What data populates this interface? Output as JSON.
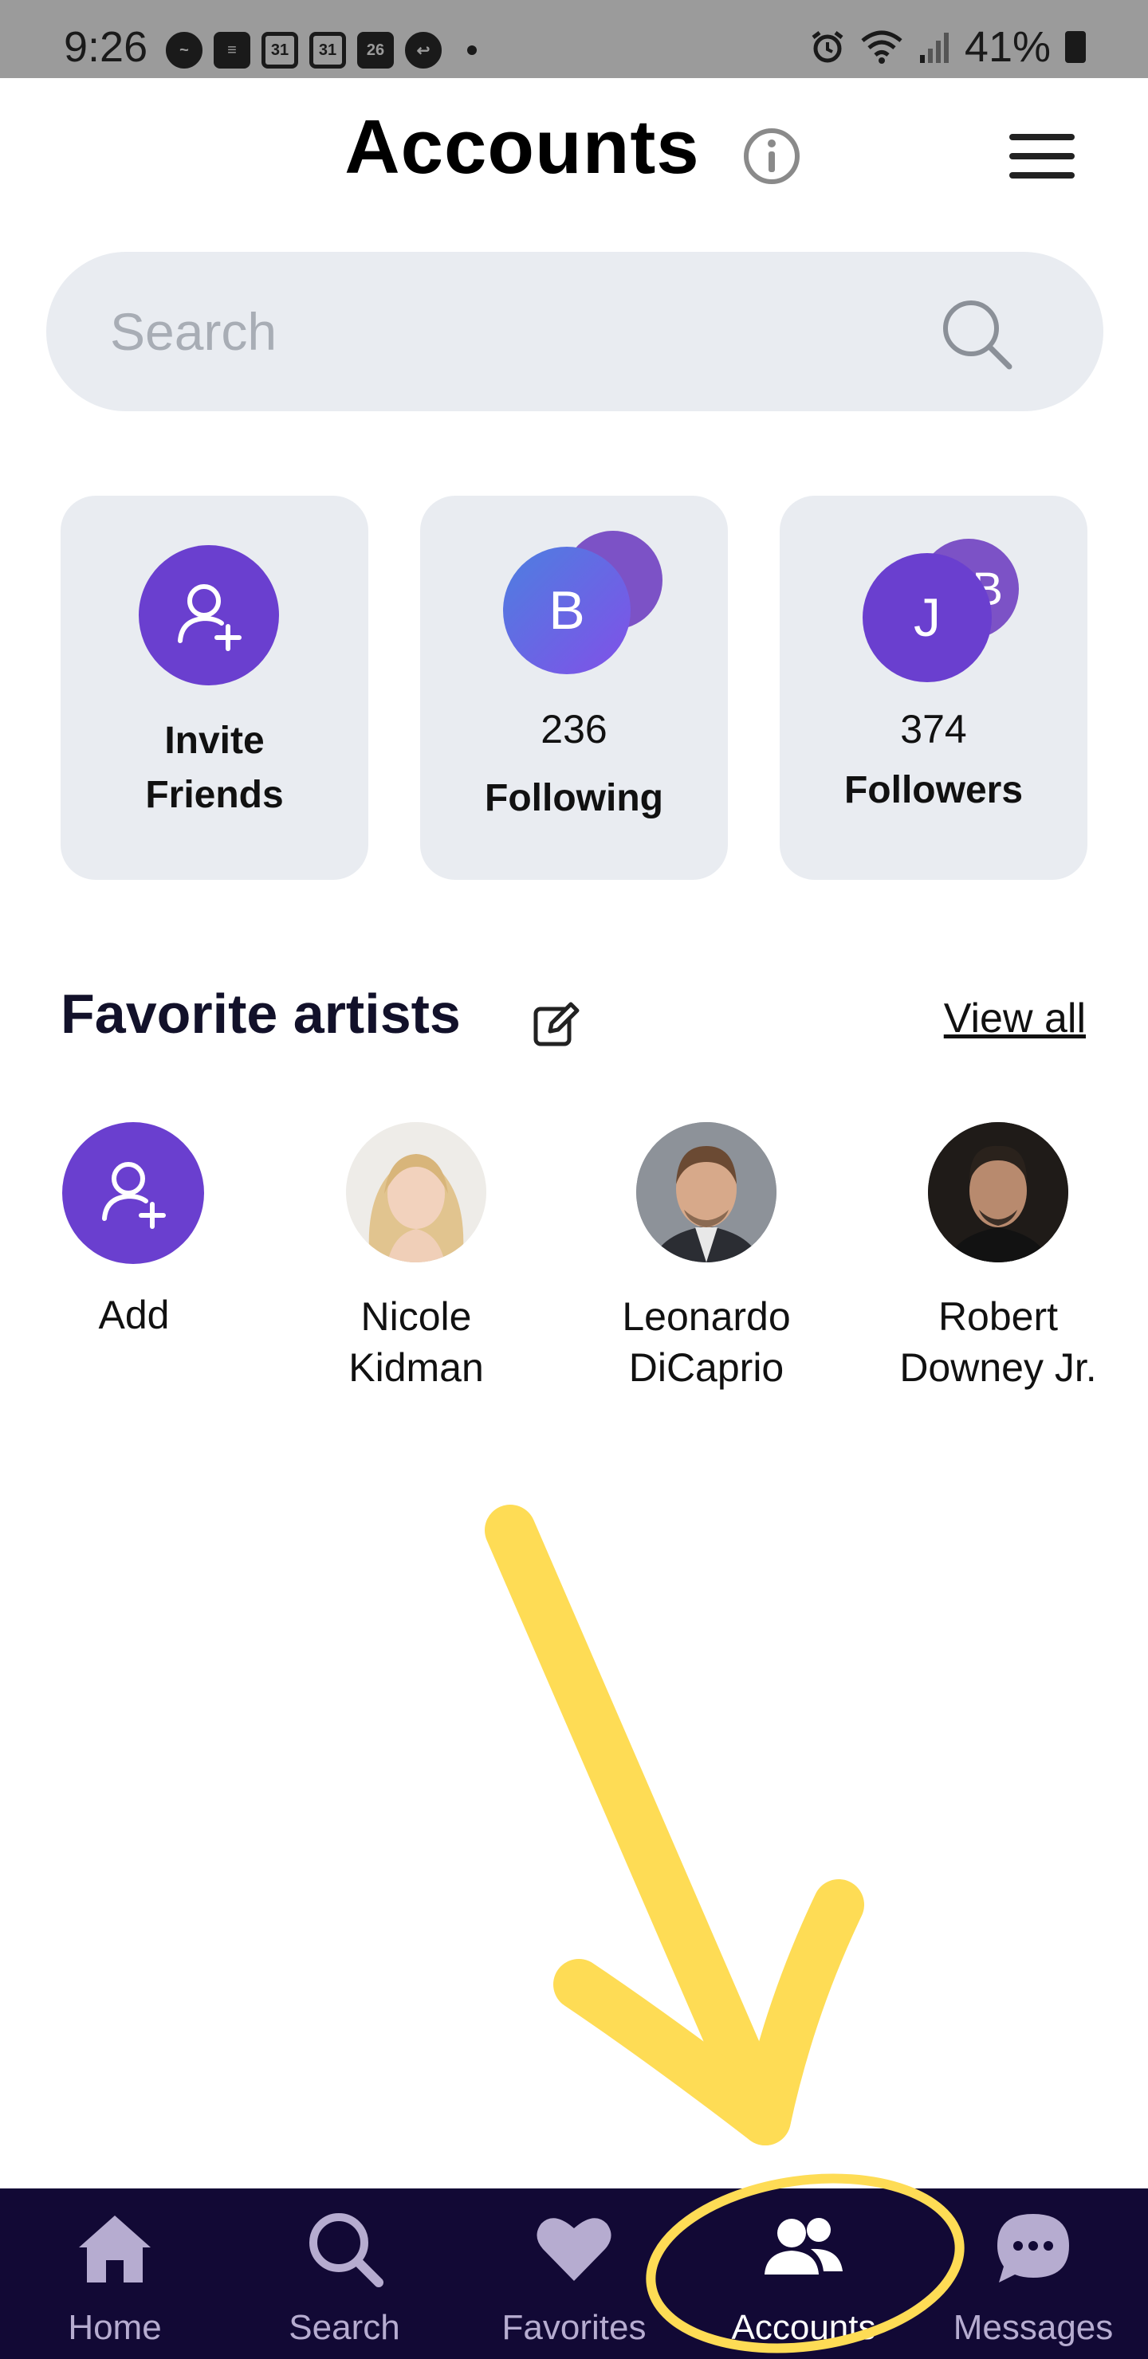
{
  "status_bar": {
    "time": "9:26",
    "battery": "41%",
    "calendar_day_a": "31",
    "calendar_day_b": "31",
    "calendar_day_c": "26"
  },
  "header": {
    "title": "Accounts"
  },
  "search": {
    "placeholder": "Search"
  },
  "stats": {
    "invite": {
      "line1": "Invite",
      "line2": "Friends"
    },
    "following": {
      "count": "236",
      "label": "Following",
      "avatar_front": "B"
    },
    "followers": {
      "count": "374",
      "label": "Followers",
      "avatar_front": "J",
      "avatar_back": "B"
    }
  },
  "favorites": {
    "title": "Favorite artists",
    "view_all": "View all",
    "add_label": "Add",
    "artists": [
      {
        "line1": "Nicole Kidman",
        "line2": ""
      },
      {
        "line1": "Leonardo",
        "line2": "DiCaprio"
      },
      {
        "line1": "Robert",
        "line2": "Downey Jr."
      }
    ]
  },
  "bottom_nav": {
    "items": [
      {
        "label": "Home",
        "icon": "home-icon"
      },
      {
        "label": "Search",
        "icon": "search-icon"
      },
      {
        "label": "Favorites",
        "icon": "heart-icon"
      },
      {
        "label": "Accounts",
        "icon": "users-icon",
        "active": true
      },
      {
        "label": "Messages",
        "icon": "chat-icon"
      }
    ]
  },
  "colors": {
    "accent_purple": "#6a3fcf",
    "nav_background": "#120935",
    "card_background": "#e9ecf1",
    "annotation_yellow": "#fedc55"
  }
}
